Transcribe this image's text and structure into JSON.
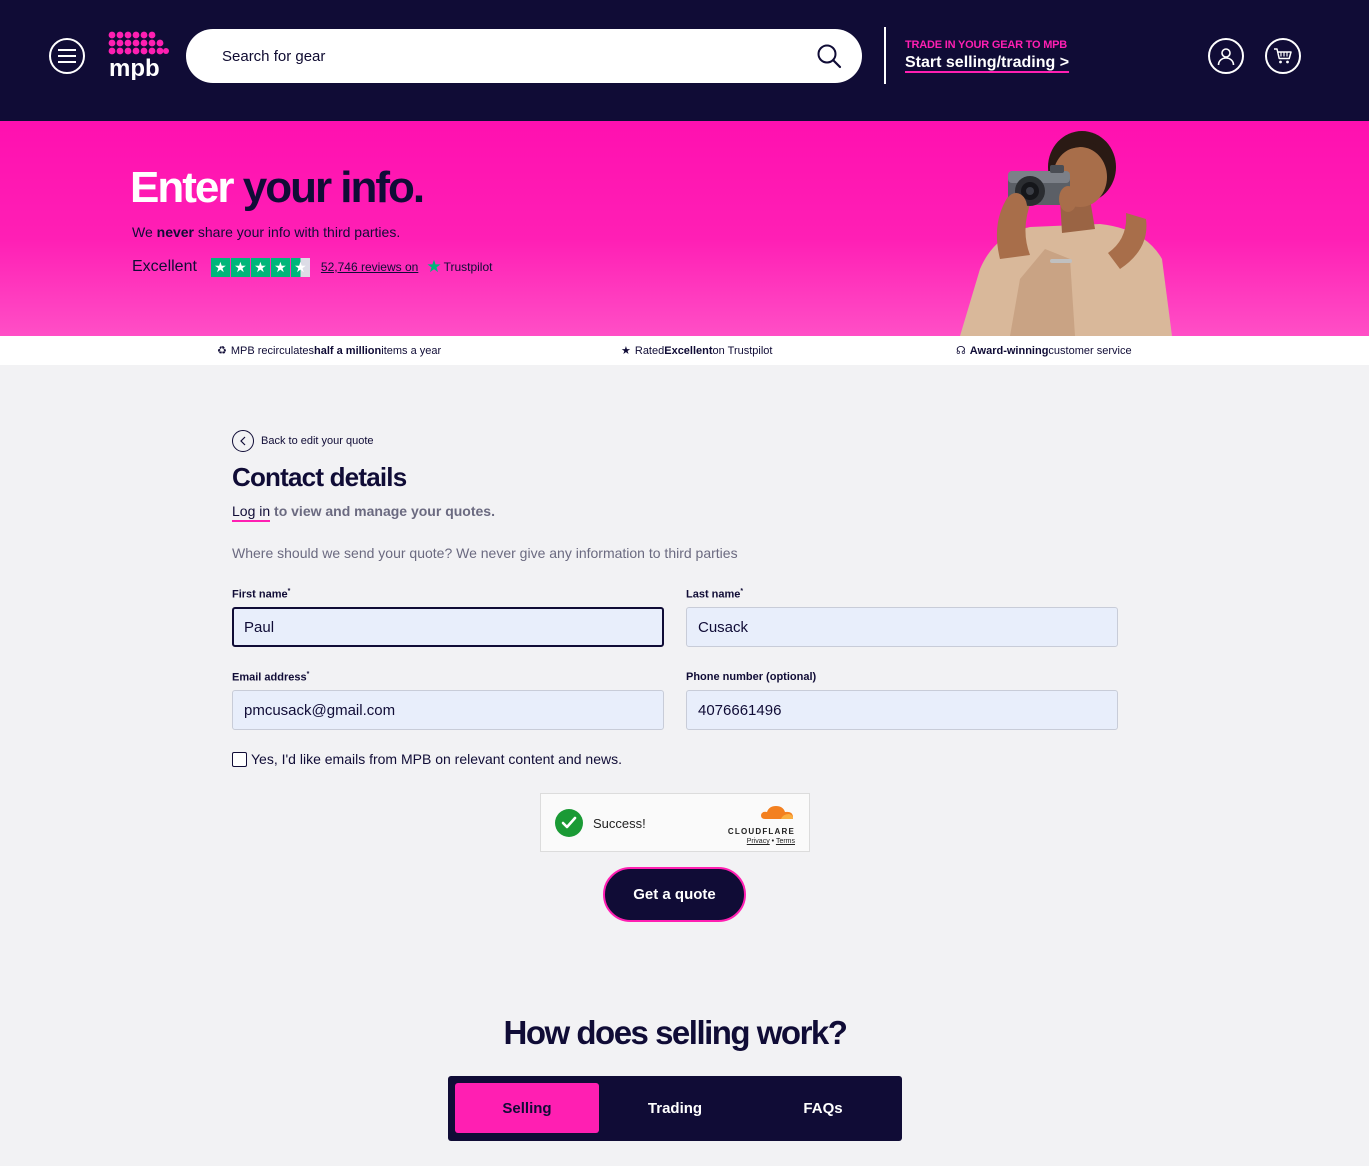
{
  "header": {
    "search_placeholder": "Search for gear",
    "trade_kicker": "TRADE IN YOUR GEAR TO MPB",
    "trade_link": "Start selling/trading >",
    "brand_text": "mpb"
  },
  "hero": {
    "title_white": "Enter",
    "title_dark": "your info.",
    "sub_before": "We ",
    "sub_bold": "never",
    "sub_after": " share your info with third parties.",
    "trustpilot": {
      "rating_label": "Excellent",
      "reviews_link": "52,746 reviews on",
      "brand": "Trustpilot"
    }
  },
  "strip": {
    "item1_before": "MPB recirculates ",
    "item1_bold": "half a million",
    "item1_after": " items a year",
    "item2_before": "Rated ",
    "item2_bold": "Excellent",
    "item2_after": " on Trustpilot",
    "item3_bold": "Award-winning",
    "item3_after": " customer service"
  },
  "form": {
    "back_label": "Back to edit your quote",
    "title": "Contact details",
    "login_link": "Log in",
    "login_rest": " to view and manage your quotes.",
    "intro": "Where should we send your quote? We never give any information to third parties",
    "first_name_label": "First name",
    "last_name_label": "Last name",
    "email_label": "Email address",
    "phone_label": "Phone number (optional)",
    "required_mark": "*",
    "first_name_value": "Paul",
    "last_name_value": "Cusack",
    "email_value": "pmcusack@gmail.com",
    "phone_value": "4076661496",
    "marketing_checkbox_label": "Yes, I'd like emails from MPB on relevant content and news.",
    "submit_label": "Get a quote"
  },
  "captcha": {
    "status": "Success!",
    "brand": "CLOUDFLARE",
    "privacy": "Privacy",
    "separator": "•",
    "terms": "Terms"
  },
  "how": {
    "title": "How does selling work?",
    "tabs": [
      {
        "label": "Selling",
        "active": true
      },
      {
        "label": "Trading",
        "active": false
      },
      {
        "label": "FAQs",
        "active": false
      }
    ]
  },
  "colors": {
    "navy": "#100c36",
    "pink": "#ff1fb2",
    "trustpilot_green": "#00b67a"
  }
}
